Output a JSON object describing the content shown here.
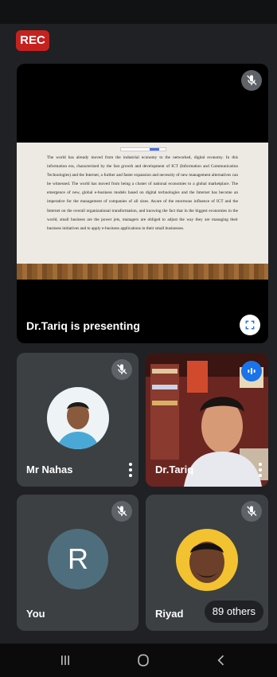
{
  "recording": {
    "label": "REC",
    "color": "#c5221f"
  },
  "presentation": {
    "presenter_label": "Dr.Tariq is presenting",
    "slide_text": "The world has already moved from the industrial economy to the networked, digital economy. In this information era, characterized by the fast growth and development of ICT (Information and Communication Technologies) and the Internet, a further and faster expansion and necessity of new management alternatives can be witnessed. The world has moved from being a cluster of national economies to a global marketplace. The emergence of new, global e-business models based on digital technologies and the Internet has become an imperative for the management of companies of all sizes. Aware of the enormous influence of ICT and the Internet on the overall organizational transformation, and knowing the fact that in the biggest economies in the world, small business are the power jets, managers are obliged to adjust the way they are managing their business initiatives and to apply e-business applications in their small businesses.",
    "icons": {
      "mute": "mic-off-icon",
      "fullscreen": "fullscreen-icon"
    }
  },
  "participants": [
    {
      "name": "Mr Nahas",
      "muted": true,
      "avatar": "photo",
      "has_menu": true
    },
    {
      "name": "Dr.Tariq",
      "muted": false,
      "speaking": true,
      "video": true,
      "has_menu": true
    },
    {
      "name": "You",
      "muted": true,
      "avatar_letter": "R"
    },
    {
      "name": "Riyad",
      "muted": true,
      "avatar": "photo",
      "others_badge": "89 others"
    }
  ],
  "colors": {
    "tile_bg": "#3c4043",
    "page_bg": "#202124",
    "speaking": "#1a73e8",
    "avatar_letter_bg": "#4f6e7d"
  },
  "navbar": {
    "icons": [
      "recent-apps-icon",
      "home-icon",
      "back-icon"
    ]
  }
}
